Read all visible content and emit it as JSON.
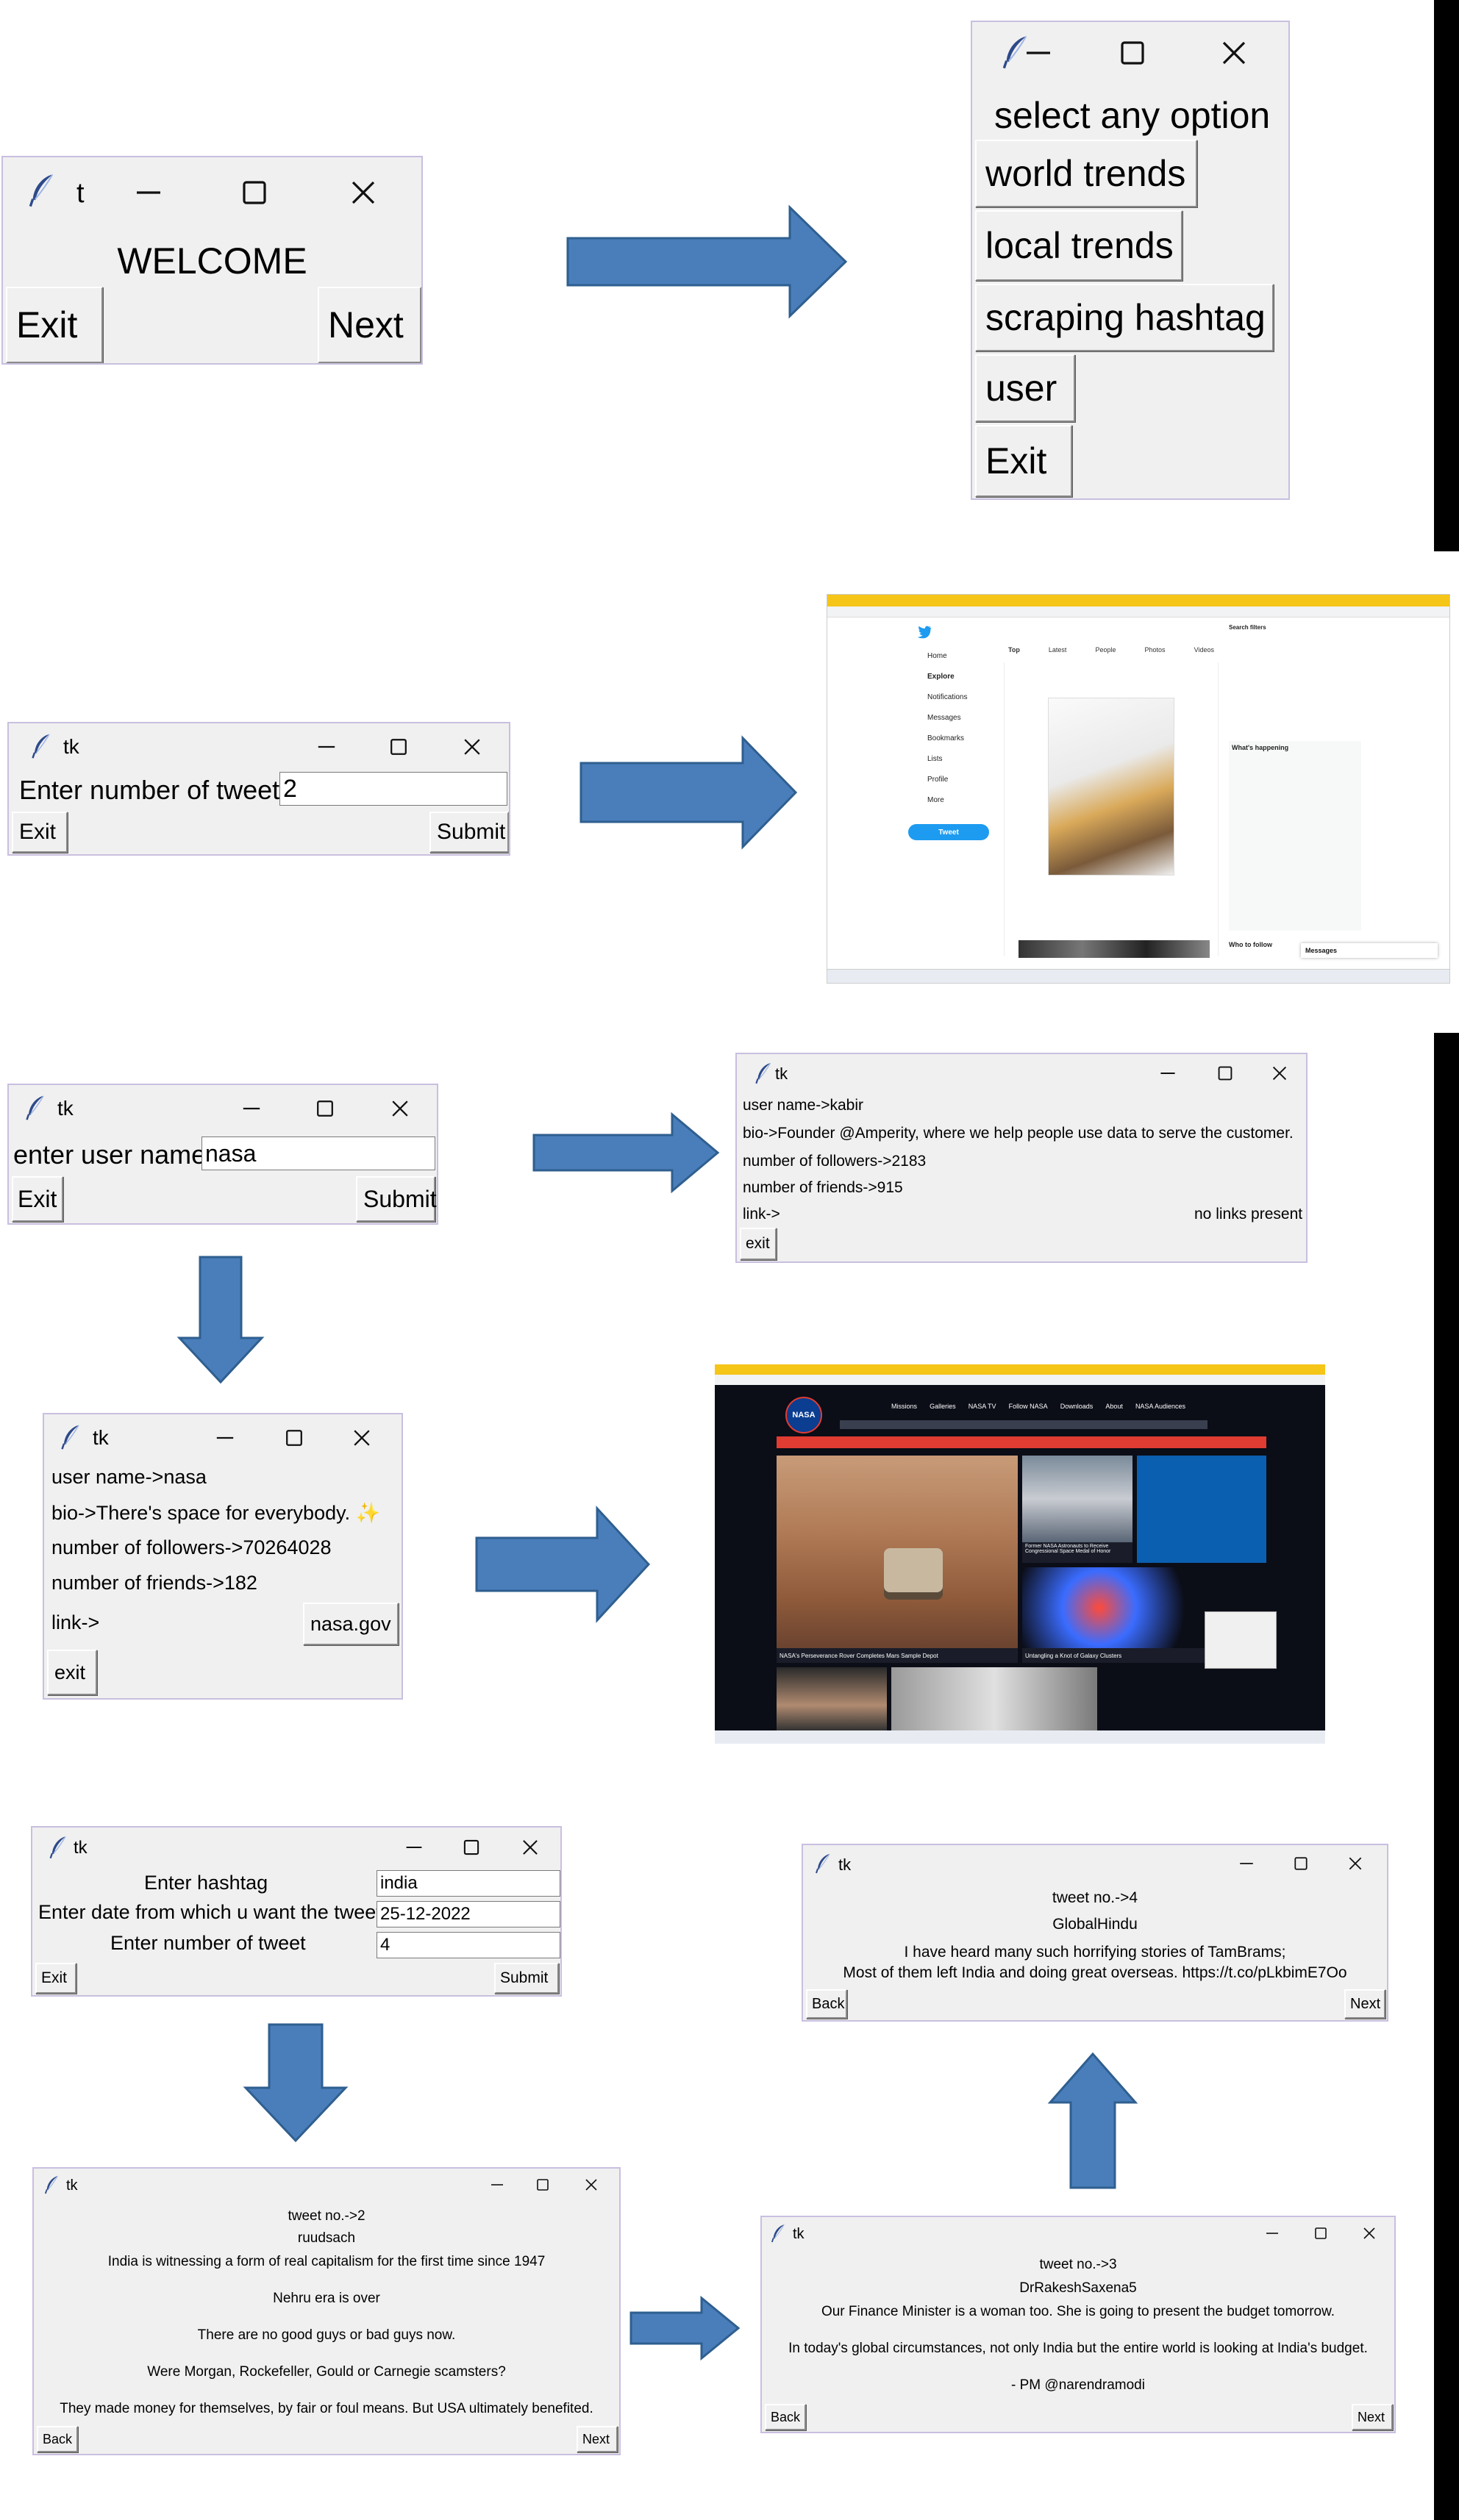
{
  "colors": {
    "arrow": "#4a7ebb",
    "arrow_border": "#2f5f8f",
    "window_bg": "#f0f0f0",
    "window_border": "#c9bfe0",
    "nasa_red": "#e03c31",
    "twitter_blue": "#1d9bf0",
    "chrome_yellow": "#f5c518"
  },
  "welcome": {
    "title": "t",
    "heading": "WELCOME",
    "exit_label": "Exit",
    "next_label": "Next"
  },
  "menu": {
    "heading": "select any option",
    "items": [
      "world trends",
      "local trends",
      "scraping hashtag",
      "user",
      "Exit"
    ]
  },
  "tweets_count": {
    "title": "tk",
    "label": "Enter number of tweets",
    "value": "2",
    "exit_label": "Exit",
    "submit_label": "Submit"
  },
  "twitter_shot": {
    "nav": [
      "Home",
      "Explore",
      "Notifications",
      "Messages",
      "Bookmarks",
      "Lists",
      "Profile",
      "More"
    ],
    "tweet_button": "Tweet",
    "tabs": [
      "Top",
      "Latest",
      "People",
      "Photos",
      "Videos"
    ],
    "side_sections": [
      "Search filters",
      "What's happening",
      "Who to follow"
    ],
    "messages_label": "Messages"
  },
  "user_input": {
    "title": "tk",
    "label": "enter user name",
    "value": "nasa",
    "exit_label": "Exit",
    "submit_label": "Submit"
  },
  "kabir": {
    "title": "tk",
    "username": "user name->kabir",
    "bio": "bio->Founder @Amperity, where we help people use data to serve the customer.",
    "followers": "number of followers->2183",
    "friends": "number of friends->915",
    "link_label": "link->",
    "link_value": "no links present",
    "exit_label": "exit"
  },
  "nasa": {
    "title": "tk",
    "username": "user name->nasa",
    "bio": "bio->There's space for everybody. ✨",
    "followers": "number of followers->70264028",
    "friends": "number of friends->182",
    "link_label": "link->",
    "link_button": "nasa.gov",
    "exit_label": "exit"
  },
  "nasa_shot": {
    "nav": [
      "Missions",
      "Galleries",
      "NASA TV",
      "Follow NASA",
      "Downloads",
      "About",
      "NASA Audiences"
    ],
    "logo": "NASA",
    "captions": [
      "NASA's Perseverance Rover Completes Mars Sample Depot",
      "Former NASA Astronauts to Receive Congressional Space Medal of Honor",
      "Untangling a Knot of Galaxy Clusters"
    ]
  },
  "hashtag_form": {
    "title": "tk",
    "labels": [
      "Enter hashtag",
      "Enter date from which u want the tweet",
      "Enter number of tweet"
    ],
    "values": [
      "india",
      "25-12-2022",
      "4"
    ],
    "exit_label": "Exit",
    "submit_label": "Submit"
  },
  "tweet2": {
    "title": "tk",
    "lines": [
      "tweet no.->2",
      "ruudsach",
      "India is witnessing a form of real capitalism for the first time since 1947",
      "Nehru era is over",
      "There are no good guys or bad guys now.",
      "Were Morgan, Rockefeller, Gould or Carnegie scamsters?",
      "They made money for themselves, by fair or foul means. But USA ultimately benefited."
    ],
    "back_label": "Back",
    "next_label": "Next"
  },
  "tweet3": {
    "title": "tk",
    "lines": [
      "tweet no.->3",
      "DrRakeshSaxena5",
      "Our Finance Minister is a woman too. She is going to present the budget tomorrow.",
      "In today's global circumstances, not only India but the entire world is looking at India's budget.",
      "- PM @narendramodi"
    ],
    "back_label": "Back",
    "next_label": "Next"
  },
  "tweet4": {
    "title": "tk",
    "lines": [
      "tweet no.->4",
      "GlobalHindu",
      "I have heard many such horrifying stories of TamBrams;",
      "Most of them left India and doing great overseas. https://t.co/pLkbimE7Oo"
    ],
    "back_label": "Back",
    "next_label": "Next"
  }
}
